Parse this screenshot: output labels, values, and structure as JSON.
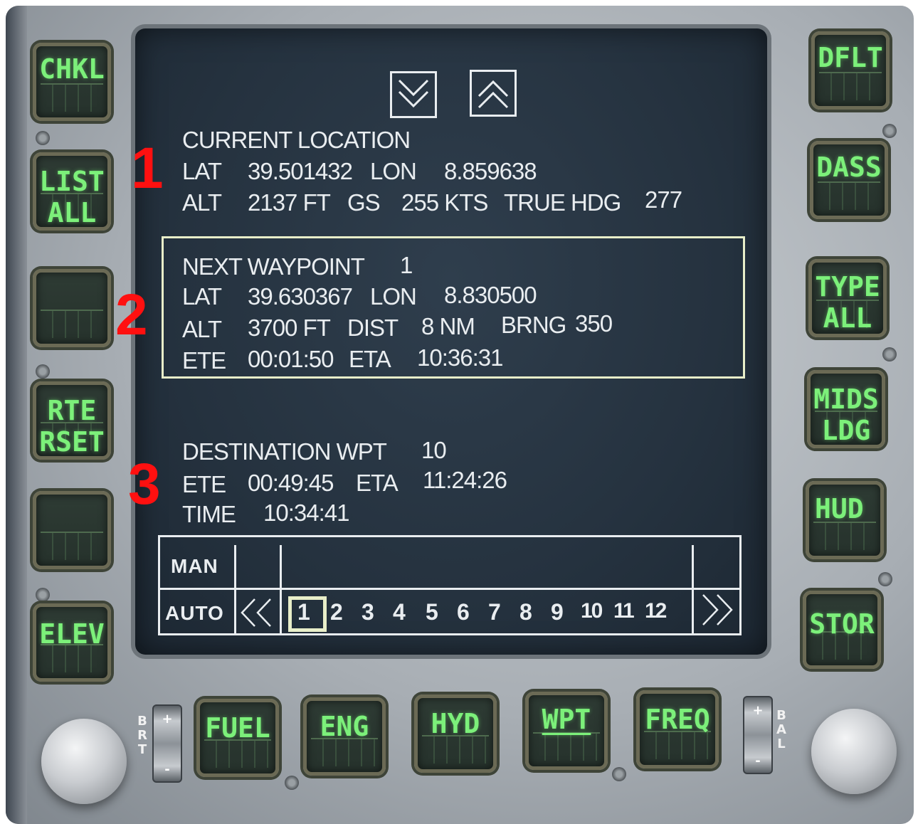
{
  "screen": {
    "current_location": {
      "header": "CURRENT LOCATION",
      "lat_label": "LAT",
      "lat": "39.501432",
      "lon_label": "LON",
      "lon": "8.859638",
      "alt_label": "ALT",
      "alt": "2137 FT",
      "gs_label": "GS",
      "gs": "255 KTS",
      "hdg_label": "TRUE HDG",
      "hdg": "277"
    },
    "next_waypoint": {
      "header": "NEXT WAYPOINT",
      "number": "1",
      "lat_label": "LAT",
      "lat": "39.630367",
      "lon_label": "LON",
      "lon": "8.830500",
      "alt_label": "ALT",
      "alt": "3700 FT",
      "dist_label": "DIST",
      "dist": "8 NM",
      "brng_label": "BRNG",
      "brng": "350",
      "ete_label": "ETE",
      "ete": "00:01:50",
      "eta_label": "ETA",
      "eta": "10:36:31"
    },
    "destination": {
      "header": "DESTINATION WPT",
      "number": "10",
      "ete_label": "ETE",
      "ete": "00:49:45",
      "eta_label": "ETA",
      "eta": "11:24:26",
      "time_label": "TIME",
      "time": "10:34:41"
    },
    "annotations": [
      "1",
      "2",
      "3"
    ],
    "mode_table": {
      "man_label": "MAN",
      "auto_label": "AUTO",
      "waypoints": [
        "1",
        "2",
        "3",
        "4",
        "5",
        "6",
        "7",
        "8",
        "9",
        "10",
        "11",
        "12"
      ],
      "selected": "1"
    }
  },
  "osb_left": [
    "CHKL",
    "LIST\nALL",
    "",
    "RTE\nRSET",
    "",
    "ELEV"
  ],
  "osb_right": [
    "DFLT",
    "DASS",
    "TYPE\nALL",
    "MIDS\nLDG",
    "HUD",
    "STOR"
  ],
  "osb_bottom": [
    "FUEL",
    "ENG",
    "HYD",
    "WPT",
    "FREQ"
  ],
  "brt_label": "B\nR\nT",
  "bal_label": "B\nA\nL",
  "rocker_plus": "+",
  "rocker_minus": "-",
  "colors": {
    "osb_text": "#7cf07a",
    "screen_bg": "#2a3846",
    "annotation": "#ff1010",
    "highlight_box": "#e8eec9"
  }
}
